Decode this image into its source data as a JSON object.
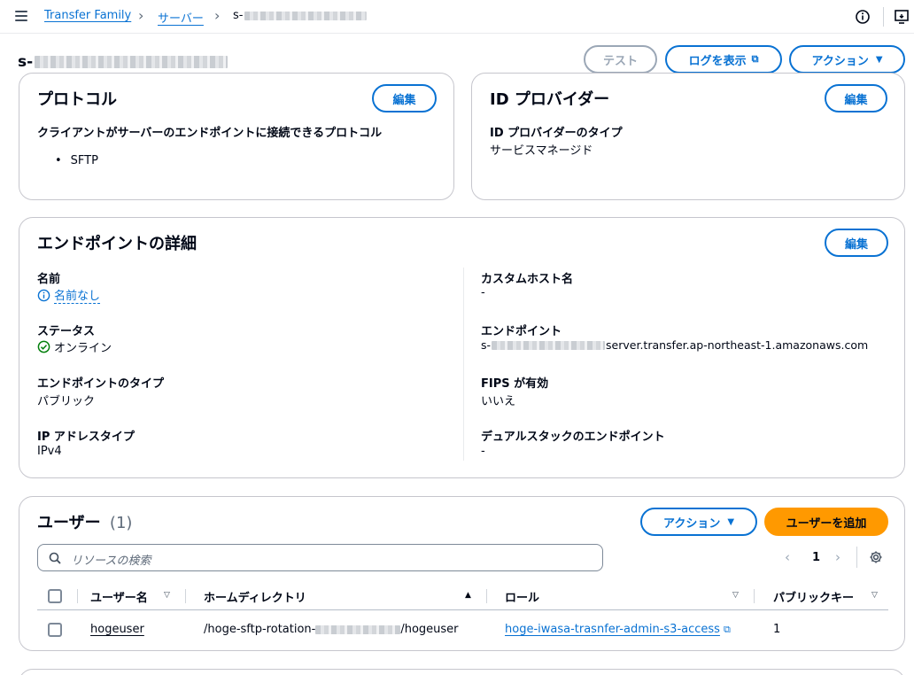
{
  "breadcrumb": {
    "items": [
      "Transfer Family",
      "サーバー",
      "s-"
    ]
  },
  "page": {
    "title_prefix": "s-",
    "buttons": {
      "test": "テスト",
      "view_logs": "ログを表示",
      "actions": "アクション"
    }
  },
  "protocol_card": {
    "title": "プロトコル",
    "edit": "編集",
    "label": "クライアントがサーバーのエンドポイントに接続できるプロトコル",
    "items": [
      "SFTP"
    ]
  },
  "idp_card": {
    "title": "ID プロバイダー",
    "edit": "編集",
    "type_label": "ID プロバイダーのタイプ",
    "type_value": "サービスマネージド"
  },
  "endpoint_card": {
    "title": "エンドポイントの詳細",
    "edit": "編集",
    "name_label": "名前",
    "name_value": "名前なし",
    "status_label": "ステータス",
    "status_value": "オンライン",
    "endpoint_type_label": "エンドポイントのタイプ",
    "endpoint_type_value": "パブリック",
    "ip_type_label": "IP アドレスタイプ",
    "ip_type_value": "IPv4",
    "custom_host_label": "カスタムホスト名",
    "custom_host_value": "-",
    "endpoint_label": "エンドポイント",
    "endpoint_prefix": "s-",
    "endpoint_suffix": "server.transfer.ap-northeast-1.amazonaws.com",
    "fips_label": "FIPS が有効",
    "fips_value": "いいえ",
    "dualstack_label": "デュアルスタックのエンドポイント",
    "dualstack_value": "-"
  },
  "users_card": {
    "title": "ユーザー",
    "count": "(1)",
    "actions": "アクション",
    "add_user": "ユーザーを追加",
    "search_placeholder": "リソースの検索",
    "page": "1",
    "columns": [
      "ユーザー名",
      "ホームディレクトリ",
      "ロール",
      "パブリックキー"
    ],
    "rows": [
      {
        "username": "hogeuser",
        "home_prefix": "/hoge-sftp-rotation-",
        "home_suffix": "/hogeuser",
        "role": "hoge-iwasa-trasnfer-admin-s3-access",
        "public_keys": "1"
      }
    ]
  },
  "colors": {
    "link": "#0972d3",
    "primary": "#ff9900",
    "success": "#037f0c"
  }
}
